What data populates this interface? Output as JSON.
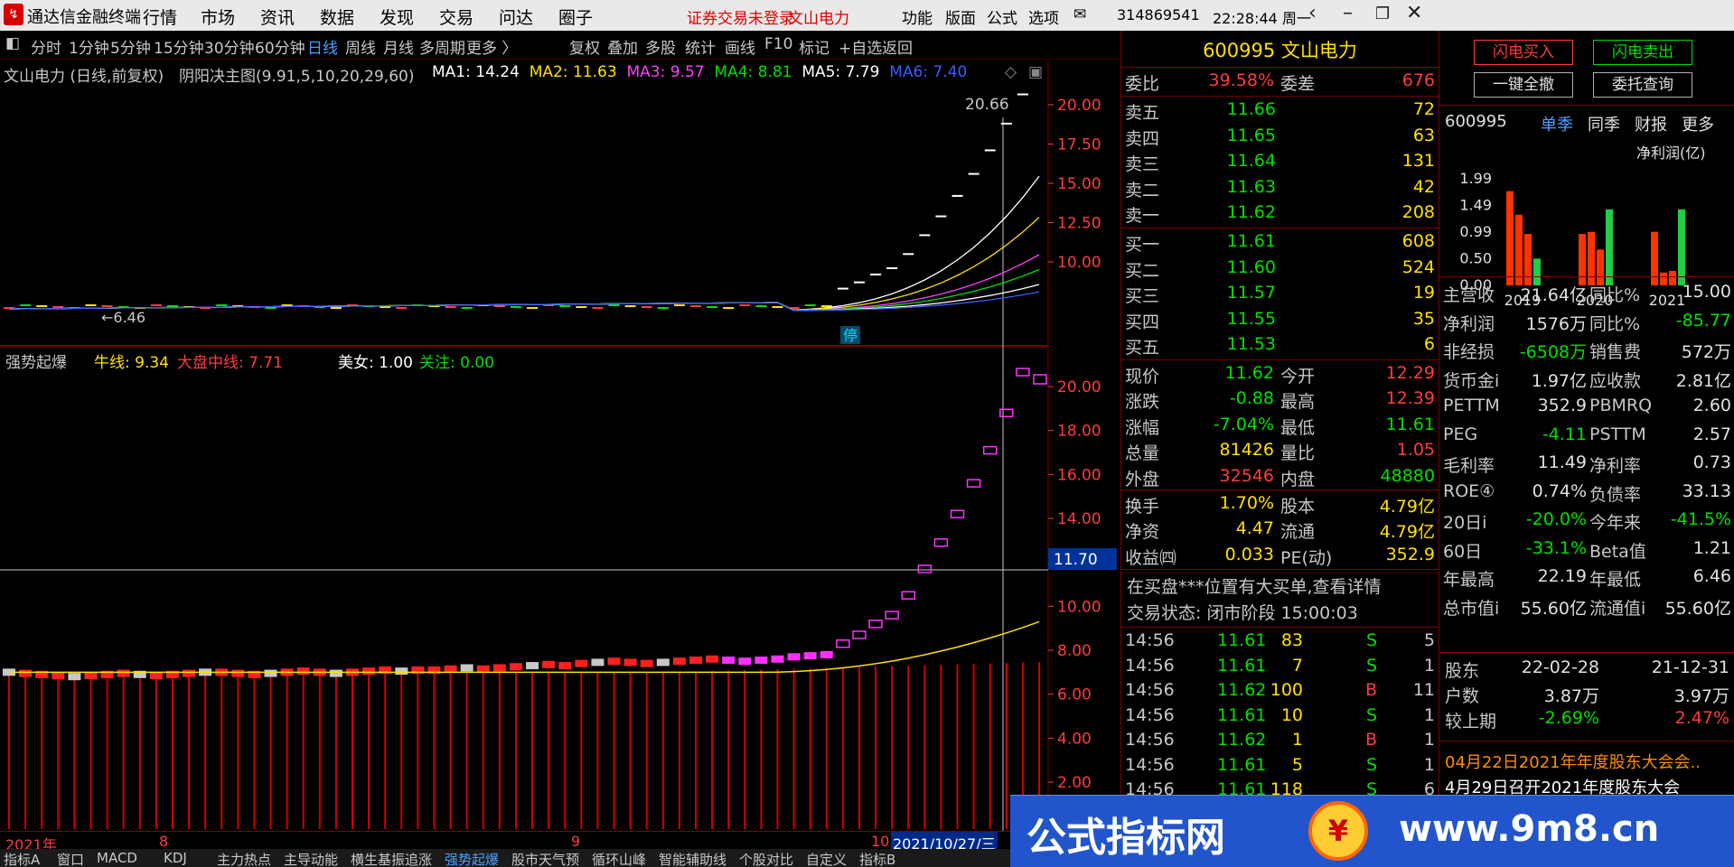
{
  "app": {
    "title": "通达信金融终端",
    "menus": [
      "行情",
      "市场",
      "资讯",
      "数据",
      "发现",
      "交易",
      "问达",
      "圈子"
    ],
    "warning": "证券交易未登录",
    "stock_name_top": "文山电力",
    "right_menus": [
      "功能",
      "版面",
      "公式",
      "选项"
    ],
    "account": "314869541",
    "clock": "22:28:44 周一"
  },
  "toolbar": {
    "periods": [
      "分时",
      "1分钟",
      "5分钟",
      "15分钟",
      "30分钟",
      "60分钟",
      "日线",
      "周线",
      "月线",
      "多周期",
      "更多 〉"
    ],
    "tools": [
      "复权",
      "叠加",
      "多股",
      "统计",
      "画线",
      "F10",
      "标记",
      "+自选",
      "返回"
    ]
  },
  "chart_top": {
    "title": "文山电力 (日线,前复权)",
    "indicator": "阴阳决主图(9.91,5,10,20,29,60)",
    "ma": [
      {
        "name": "MA1",
        "value": "14.24",
        "color": "#ffffff"
      },
      {
        "name": "MA2",
        "value": "11.63",
        "color": "#ffe000"
      },
      {
        "name": "MA3",
        "value": "9.57",
        "color": "#ff40ff"
      },
      {
        "name": "MA4",
        "value": "8.81",
        "color": "#00e000"
      },
      {
        "name": "MA5",
        "value": "7.79",
        "color": "#ffffff"
      },
      {
        "name": "MA6",
        "value": "7.40",
        "color": "#3a5cff"
      }
    ],
    "high_label": "20.66",
    "low_label": "6.46",
    "stop_label": "停",
    "yticks": [
      "20.00",
      "17.50",
      "15.00",
      "12.50",
      "10.00"
    ]
  },
  "chart_bottom": {
    "title": "强势起爆",
    "niu_label": "牛线:",
    "niu_value": "9.34",
    "dapan_label": "大盘中线:",
    "dapan_value": "7.71",
    "meinv_label": "美女:",
    "meinv_value": "1.00",
    "guanzhu_label": "关注:",
    "guanzhu_value": "0.00",
    "yticks": [
      "20.00",
      "18.00",
      "16.00",
      "14.00",
      "12.00",
      "10.00",
      "8.00",
      "6.00",
      "4.00",
      "2.00"
    ],
    "cursor_value": "11.70"
  },
  "date_axis": {
    "year": "2021年",
    "m8": "8",
    "m9": "9",
    "m10": "10",
    "cursor_date": "2021/10/27/三"
  },
  "bottom_tabs": [
    "指标A",
    "窗口",
    "MACD",
    "KDJ",
    "主力热点",
    "主导动能",
    "横生基振追涨",
    "强势起爆",
    "股市天气预",
    "循环山峰",
    "智能辅助线",
    "个股对比",
    "自定义",
    "指标B"
  ],
  "quote": {
    "code": "600995",
    "name": "文山电力",
    "weibi_label": "委比",
    "weibi": "39.58%",
    "weicha_label": "委差",
    "weicha": "676",
    "sells": [
      {
        "label": "卖五",
        "price": "11.66",
        "vol": "72"
      },
      {
        "label": "卖四",
        "price": "11.65",
        "vol": "63"
      },
      {
        "label": "卖三",
        "price": "11.64",
        "vol": "131"
      },
      {
        "label": "卖二",
        "price": "11.63",
        "vol": "42"
      },
      {
        "label": "卖一",
        "price": "11.62",
        "vol": "208"
      }
    ],
    "buys": [
      {
        "label": "买一",
        "price": "11.61",
        "vol": "608"
      },
      {
        "label": "买二",
        "price": "11.60",
        "vol": "524"
      },
      {
        "label": "买三",
        "price": "11.57",
        "vol": "19"
      },
      {
        "label": "买四",
        "price": "11.55",
        "vol": "35"
      },
      {
        "label": "买五",
        "price": "11.53",
        "vol": "6"
      }
    ],
    "stats": [
      {
        "l1": "现价",
        "v1": "11.62",
        "l2": "今开",
        "v2": "12.29"
      },
      {
        "l1": "涨跌",
        "v1": "-0.88",
        "l2": "最高",
        "v2": "12.39"
      },
      {
        "l1": "涨幅",
        "v1": "-7.04%",
        "l2": "最低",
        "v2": "11.61"
      },
      {
        "l1": "总量",
        "v1": "81426",
        "l2": "量比",
        "v2": "1.05"
      },
      {
        "l1": "外盘",
        "v1": "32546",
        "l2": "内盘",
        "v2": "48880"
      }
    ],
    "stats2": [
      {
        "l1": "换手",
        "v1": "1.70%",
        "l2": "股本",
        "v2": "4.79亿"
      },
      {
        "l1": "净资",
        "v1": "4.47",
        "l2": "流通",
        "v2": "4.79亿"
      },
      {
        "l1": "收益㈣",
        "v1": "0.033",
        "l2": "PE(动)",
        "v2": "352.9"
      }
    ],
    "notice": "在买盘***位置有大买单,查看详情",
    "status": "交易状态: 闭市阶段 15:00:03",
    "ticks": [
      {
        "t": "14:56",
        "p": "11.61",
        "v": "83",
        "bs": "S",
        "n": "5"
      },
      {
        "t": "14:56",
        "p": "11.61",
        "v": "7",
        "bs": "S",
        "n": "1"
      },
      {
        "t": "14:56",
        "p": "11.62",
        "v": "100",
        "bs": "B",
        "n": "11"
      },
      {
        "t": "14:56",
        "p": "11.61",
        "v": "10",
        "bs": "S",
        "n": "1"
      },
      {
        "t": "14:56",
        "p": "11.62",
        "v": "1",
        "bs": "B",
        "n": "1"
      },
      {
        "t": "14:56",
        "p": "11.61",
        "v": "5",
        "bs": "S",
        "n": "1"
      },
      {
        "t": "14:56",
        "p": "11.61",
        "v": "118",
        "bs": "S",
        "n": "6"
      }
    ]
  },
  "right": {
    "btn_buy": "闪电买入",
    "btn_sell": "闪电卖出",
    "btn_cancel": "一键全撤",
    "btn_query": "委托查询",
    "code": "600995",
    "tabs": [
      "单季",
      "同季",
      "财报",
      "更多"
    ],
    "chart_title": "净利润(亿)",
    "yticks": [
      "1.99",
      "1.49",
      "0.99",
      "0.50",
      "0.00"
    ],
    "years": [
      "2019",
      "2020",
      "2021"
    ],
    "bars": [
      1.76,
      1.32,
      0.96,
      0.5,
      0.96,
      1.0,
      0.67,
      1.42,
      1.0,
      0.24,
      0.27,
      1.42
    ],
    "fin": [
      {
        "l1": "主营收",
        "v1": "21.64亿",
        "l2": "同比%",
        "v2": "15.00"
      },
      {
        "l1": "净利润",
        "v1": "1576万",
        "l2": "同比%",
        "v2": "-85.77"
      },
      {
        "l1": "非经损",
        "v1": "-6508万",
        "l2": "销售费",
        "v2": "572万"
      },
      {
        "l1": "货币金i",
        "v1": "1.97亿",
        "l2": "应收款",
        "v2": "2.81亿"
      },
      {
        "l1": "PETTM",
        "v1": "352.9",
        "l2": "PBMRQ",
        "v2": "2.60"
      },
      {
        "l1": "PEG",
        "v1": "-4.11",
        "l2": "PSTTM",
        "v2": "2.57"
      },
      {
        "l1": "毛利率",
        "v1": "11.49",
        "l2": "净利率",
        "v2": "0.73"
      },
      {
        "l1": "ROE④",
        "v1": "0.74%",
        "l2": "负债率",
        "v2": "33.13"
      },
      {
        "l1": "20日i",
        "v1": "-20.0%",
        "l2": "今年来",
        "v2": "-41.5%"
      },
      {
        "l1": "60日",
        "v1": "-33.1%",
        "l2": "Beta值",
        "v2": "1.21"
      },
      {
        "l1": "年最高",
        "v1": "22.19",
        "l2": "年最低",
        "v2": "6.46"
      },
      {
        "l1": "总市值i",
        "v1": "55.60亿",
        "l2": "流通值i",
        "v2": "55.60亿"
      }
    ],
    "holders": {
      "label": "股东",
      "d1": "22-02-28",
      "d2": "21-12-31",
      "r1l": "户数",
      "r1a": "3.87万",
      "r1b": "3.97万",
      "r2l": "较上期",
      "r2a": "-2.69%",
      "r2b": "2.47%"
    },
    "news": [
      "04月22日2021年年度股东大会会..",
      "4月29日召开2021年度股东大会"
    ]
  },
  "watermark": {
    "text": "公式指标网",
    "url": "www.9m8.cn"
  },
  "chart_data": {
    "type": "candlestick",
    "title": "文山电力 (日线,前复权)",
    "xlabel": "",
    "ylabel": "",
    "ylim": [
      6.46,
      20.66
    ],
    "closes": [
      7.0,
      6.95,
      6.9,
      6.85,
      6.8,
      6.85,
      6.9,
      6.95,
      6.9,
      6.85,
      6.9,
      6.95,
      7.0,
      7.0,
      6.95,
      6.9,
      6.95,
      7.0,
      7.05,
      7.0,
      6.95,
      7.0,
      7.05,
      7.1,
      7.05,
      7.1,
      7.1,
      7.15,
      7.2,
      7.15,
      7.2,
      7.25,
      7.3,
      7.35,
      7.3,
      7.4,
      7.45,
      7.5,
      7.45,
      7.4,
      7.45,
      7.5,
      7.55,
      7.6,
      7.55,
      7.5,
      7.55,
      7.6,
      7.7,
      7.75,
      7.8,
      8.3,
      8.7,
      9.2,
      9.6,
      10.5,
      11.7,
      12.9,
      14.2,
      15.6,
      17.1,
      18.8,
      20.66,
      11.62
    ]
  }
}
